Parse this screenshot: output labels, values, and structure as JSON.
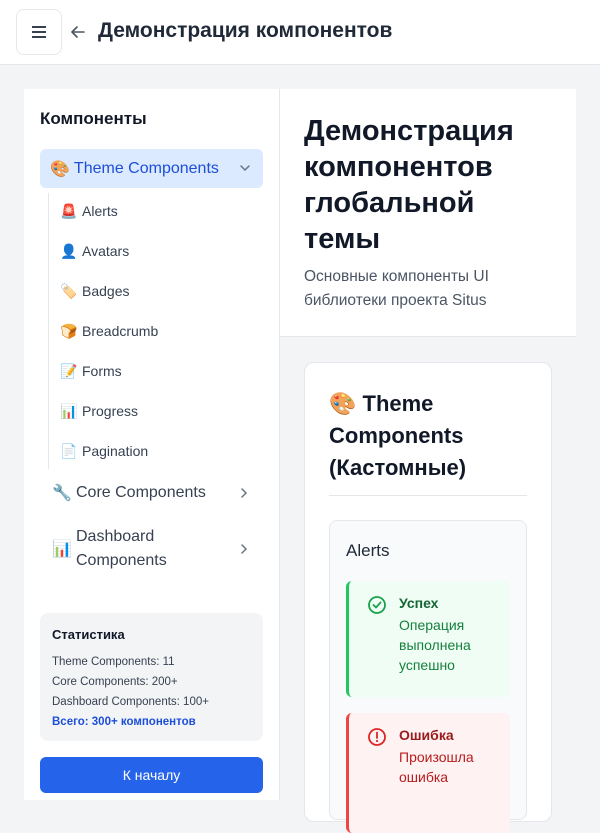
{
  "header": {
    "title": "Демонстрация компонентов"
  },
  "sidebar": {
    "heading": "Компоненты",
    "active_group": {
      "emoji": "🎨",
      "label": "Theme Components"
    },
    "sub_items": [
      {
        "emoji": "🚨",
        "label": "Alerts"
      },
      {
        "emoji": "👤",
        "label": "Avatars"
      },
      {
        "emoji": "🏷️",
        "label": "Badges"
      },
      {
        "emoji": "🍞",
        "label": "Breadcrumb"
      },
      {
        "emoji": "📝",
        "label": "Forms"
      },
      {
        "emoji": "📊",
        "label": "Progress"
      },
      {
        "emoji": "📄",
        "label": "Pagination"
      }
    ],
    "groups": [
      {
        "emoji": "🔧",
        "label": "Core Components"
      },
      {
        "emoji": "📊",
        "label_line1": "Dashboard",
        "label_line2": "Components"
      }
    ],
    "stats": {
      "title": "Статистика",
      "lines": [
        "Theme Components: 11",
        "Core Components: 200+",
        "Dashboard Components: 100+"
      ],
      "total": "Всего: 300+ компонентов"
    },
    "home_button": "К началу"
  },
  "main": {
    "title_lines": [
      "Демонстрация",
      "компонентов",
      "глобальной",
      "темы"
    ],
    "subtitle_lines": [
      "Основные компоненты UI",
      "библиотеки проекта Situs"
    ],
    "card": {
      "title_lines": [
        "🎨 Theme",
        "Components",
        "(Кастомные)"
      ],
      "alerts_title": "Alerts",
      "alerts": [
        {
          "type": "success",
          "title": "Успех",
          "text_lines": [
            "Операция",
            "выполнена",
            "успешно"
          ]
        },
        {
          "type": "error",
          "title": "Ошибка",
          "text_lines": [
            "Произошла",
            "ошибка"
          ]
        }
      ]
    }
  },
  "colors": {
    "accent": "#2563eb",
    "active_bg": "#dbeafe",
    "success": "#22c55e",
    "error": "#ef4444"
  },
  "icons": [
    "menu-icon",
    "back-arrow-icon",
    "chevron-down-icon",
    "chevron-right-icon",
    "check-circle-icon",
    "alert-circle-icon"
  ]
}
